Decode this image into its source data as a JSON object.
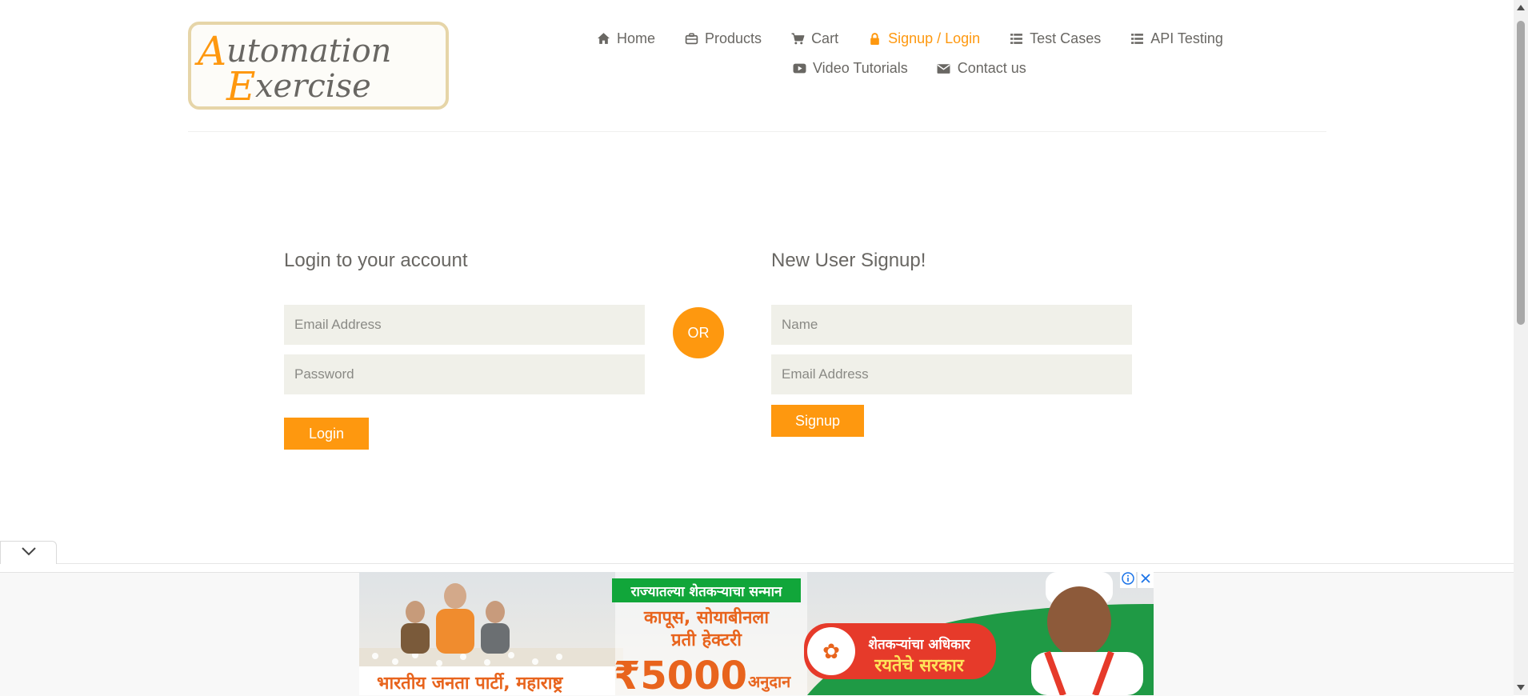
{
  "brand": {
    "logo_line1": "Automation",
    "logo_line2": "Exercise",
    "logo_accent_color": "#fe980f",
    "logo_text_color": "#696763"
  },
  "nav": {
    "items": [
      {
        "label": "Home",
        "icon": "home-icon",
        "active": false
      },
      {
        "label": "Products",
        "icon": "briefcase-icon",
        "active": false
      },
      {
        "label": "Cart",
        "icon": "cart-icon",
        "active": false
      },
      {
        "label": "Signup / Login",
        "icon": "lock-icon",
        "active": true
      },
      {
        "label": "Test Cases",
        "icon": "list-icon",
        "active": false
      },
      {
        "label": "API Testing",
        "icon": "list-icon",
        "active": false
      },
      {
        "label": "Video Tutorials",
        "icon": "youtube-icon",
        "active": false
      },
      {
        "label": "Contact us",
        "icon": "envelope-icon",
        "active": false
      }
    ]
  },
  "login": {
    "heading": "Login to your account",
    "email_placeholder": "Email Address",
    "password_placeholder": "Password",
    "button_label": "Login"
  },
  "or_label": "OR",
  "signup": {
    "heading": "New User Signup!",
    "name_placeholder": "Name",
    "email_placeholder": "Email Address",
    "button_label": "Signup"
  },
  "ad": {
    "banner_top": "राज्यातल्या शेतकऱ्याचा सन्मान",
    "line1": "कापूस, सोयाबीनला",
    "line2": "प्रती हेक्टरी",
    "amount": "₹5000",
    "amount_suffix": "अनुदान",
    "party": "भारतीय जनता पार्टी, महाराष्ट्र",
    "badge_line1": "शेतकऱ्यांचा अधिकार",
    "badge_line2": "रयतेचे सरकार",
    "info_icon": "info-icon",
    "close_icon": "close-icon"
  },
  "colors": {
    "accent": "#fe980f",
    "text": "#696763",
    "field_bg": "#f0f0e9"
  }
}
